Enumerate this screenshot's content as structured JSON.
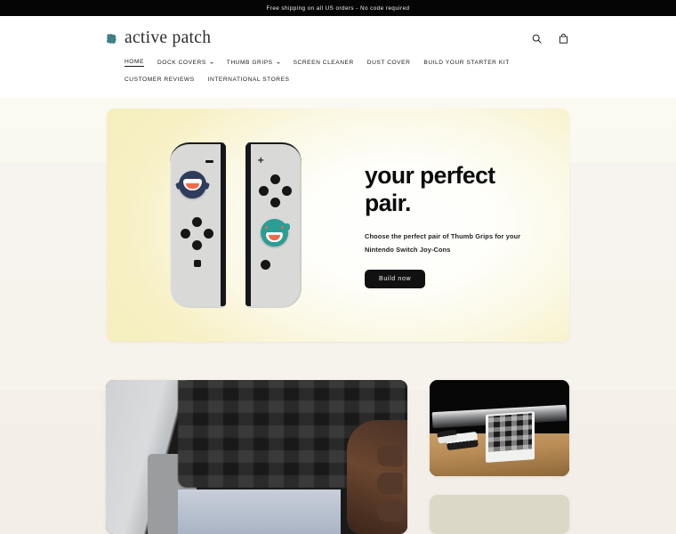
{
  "announcement": {
    "text": "Free shipping on all US orders - No code required"
  },
  "header": {
    "brand_name": "active patch",
    "brand_mark_icon": "patch-icon",
    "search_icon": "search-icon",
    "cart_icon": "shopping-bag-icon",
    "accent_color": "#3f7f85"
  },
  "nav": {
    "items": [
      {
        "label": "Home",
        "active": true,
        "has_dropdown": false
      },
      {
        "label": "Dock Covers",
        "active": false,
        "has_dropdown": true
      },
      {
        "label": "Thumb Grips",
        "active": false,
        "has_dropdown": true
      },
      {
        "label": "Screen Cleaner",
        "active": false,
        "has_dropdown": false
      },
      {
        "label": "Dust Cover",
        "active": false,
        "has_dropdown": false
      },
      {
        "label": "Build your Starter Kit",
        "active": false,
        "has_dropdown": false
      },
      {
        "label": "Customer Reviews",
        "active": false,
        "has_dropdown": false
      },
      {
        "label": "International Stores",
        "active": false,
        "has_dropdown": false
      }
    ]
  },
  "hero": {
    "title": "your perfect\npair.",
    "subtitle": "Choose the perfect pair of Thumb Grips for your Nintendo Switch Joy-Cons",
    "cta_label": "Build now",
    "cta_color": "#111111",
    "background_color": "#f5eebd",
    "left_controller": {
      "name": "left-joycon",
      "grip_character": "shark-thumb-grip",
      "grip_color": "#2f3d5c",
      "minus_button": "−"
    },
    "right_controller": {
      "name": "right-joycon",
      "grip_character": "teal-creature-thumb-grip",
      "grip_color": "#2a9e94",
      "plus_button": "+"
    }
  },
  "gallery": {
    "cards": [
      {
        "name": "dock-cover-install-photo",
        "alt": "Hand placing a dark plaid dock cover onto a Nintendo Switch dock"
      },
      {
        "name": "dock-cover-desk-photo",
        "alt": "Switch dock with plaid cover and Joy-Cons on a wooden desk"
      },
      {
        "name": "placeholder-card",
        "alt": "Beige placeholder card",
        "color": "#dcd8c8"
      }
    ]
  }
}
